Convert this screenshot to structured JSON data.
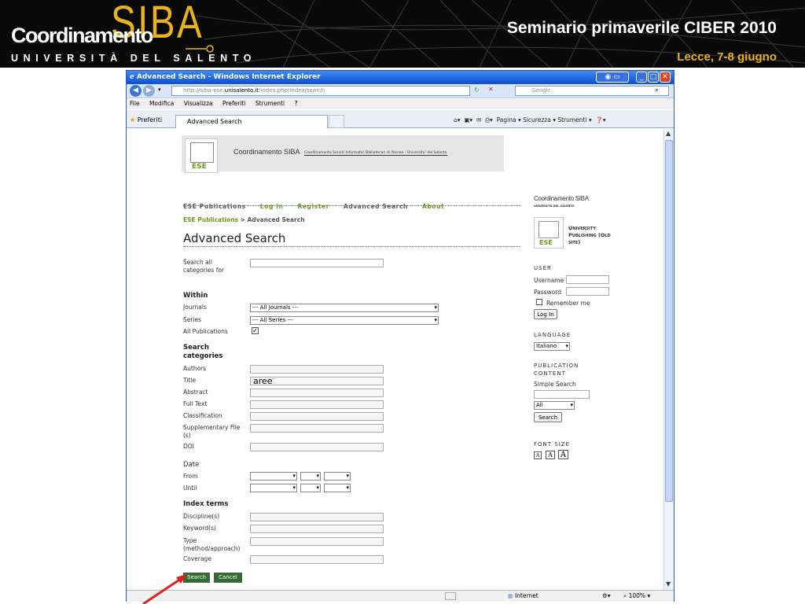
{
  "banner": {
    "logo_left": "Coordinamento",
    "logo_big": "SIBA",
    "logo_sub": "UNIVERSITÀ DEL SALENTO",
    "title": "Seminario primaverile CIBER 2010",
    "subtitle": "Lecce, 7-8 giugno"
  },
  "browser": {
    "window_title": "Advanced Search - Windows Internet Explorer",
    "url_prefix": "http://siba-ese.",
    "url_host": "unisalento.it",
    "url_path": "/index.php/index/search",
    "search_placeholder": "Google",
    "menu": [
      "File",
      "Modifica",
      "Visualizza",
      "Preferiti",
      "Strumenti",
      "?"
    ],
    "favorites_label": "Preferiti",
    "tab_label": "Advanced Search",
    "commands": "Pagina ▾   Sicurezza ▾   Strumenti ▾",
    "status_zone": "Internet",
    "zoom": "100%"
  },
  "page": {
    "header_logo_text": "Coordinamento SIBA",
    "header_tagline": "Coordinamento Servizi Informatici Bibliotecari di Ateneo - Universita' del Salento",
    "badge_text": "ESE",
    "nav": [
      "ESE Publications",
      "Log In",
      "Register",
      "Advanced Search",
      "About"
    ],
    "breadcrumb_link": "ESE Publications",
    "breadcrumb_current": "> Advanced Search",
    "heading": "Advanced Search",
    "search_all_label": "Search all categories for",
    "within_heading": "Within",
    "journals_label": "Journals",
    "journals_value": "--- All Journals ---",
    "series_label": "Series",
    "series_value": "--- All Series ---",
    "all_pubs_label": "All Publications",
    "all_pubs_checked": true,
    "categories_heading": "Search categories",
    "fields": {
      "authors": "Authors",
      "title": "Title",
      "abstract": "Abstract",
      "full_text": "Full Text",
      "classification": "Classification",
      "supp_file": "Supplementary File (s)",
      "doi": "DOI"
    },
    "title_value": "aree",
    "date_heading": "Date",
    "from_label": "From",
    "until_label": "Until",
    "index_heading": "Index terms",
    "index_fields": {
      "discipline": "Discipline(s)",
      "keywords": "Keyword(s)",
      "type": "Type (method/approach)",
      "coverage": "Coverage"
    },
    "search_button": "Search",
    "cancel_button": "Cancel"
  },
  "sidebar": {
    "logo_text": "Coordinamento SIBA",
    "logo_sub": "UNIVERSITÀ DEL SALENTO",
    "ese_label": "ESE",
    "up_text": "University Publishing (Old site)",
    "user_heading": "USER",
    "username_label": "Username",
    "password_label": "Password",
    "remember_label": "Remember me",
    "login_button": "Log In",
    "language_heading": "LANGUAGE",
    "language_value": "Italiano",
    "pubcontent_heading": "PUBLICATION CONTENT",
    "simple_search_label": "Simple Search",
    "scope_value": "All",
    "search_button": "Search",
    "fontsize_heading": "FONT SIZE",
    "font_a": [
      "A",
      "A",
      "A"
    ]
  },
  "colors": {
    "accent_green": "#6a9a1a",
    "banner_gold": "#e8b21a",
    "ie_blue": "#0c4ed1",
    "arrow_red": "#e02020"
  }
}
